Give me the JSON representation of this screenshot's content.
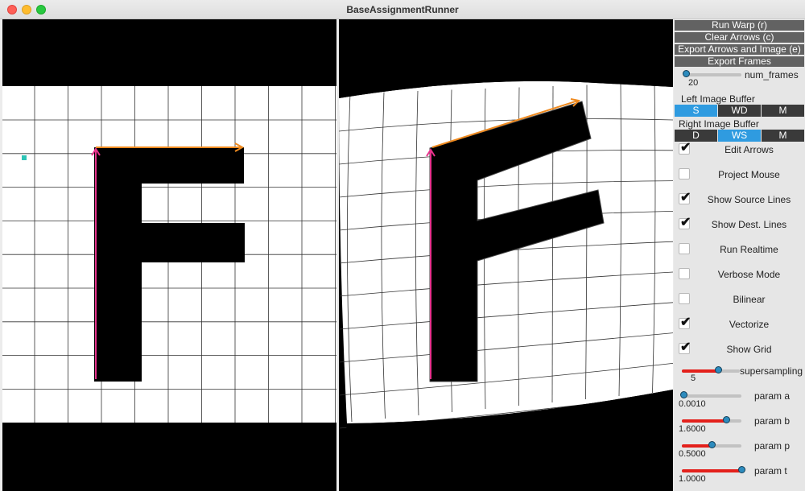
{
  "window": {
    "title": "BaseAssignmentRunner"
  },
  "colors": {
    "source_arrow": "#e8338d",
    "dest_arrow": "#ef8a1f",
    "accent": "#2f9be0",
    "slider_fill": "#e3201b",
    "marker": "#2ec4b6"
  },
  "buttons": {
    "run_warp": "Run Warp (r)",
    "clear_arrows": "Clear Arrows (c)",
    "export": "Export Arrows and Image (e)",
    "export_frames": "Export Frames"
  },
  "num_frames": {
    "label": "num_frames",
    "value": "20",
    "fraction": 0.04
  },
  "left_buffer": {
    "label": "Left Image Buffer",
    "options": [
      "S",
      "WD",
      "M"
    ],
    "selected": "S"
  },
  "right_buffer": {
    "label": "Right Image Buffer",
    "options": [
      "D",
      "WS",
      "M"
    ],
    "selected": "WS"
  },
  "checkboxes": [
    {
      "label": "Edit Arrows",
      "checked": true
    },
    {
      "label": "Project Mouse",
      "checked": false
    },
    {
      "label": "Show Source Lines",
      "checked": true
    },
    {
      "label": "Show Dest. Lines",
      "checked": true
    },
    {
      "label": "Run Realtime",
      "checked": false
    },
    {
      "label": "Verbose Mode",
      "checked": false
    },
    {
      "label": "Bilinear",
      "checked": false
    },
    {
      "label": "Vectorize",
      "checked": true
    },
    {
      "label": "Show Grid",
      "checked": true
    }
  ],
  "sliders": [
    {
      "label": "supersampling",
      "value": "5",
      "fraction": 0.62
    },
    {
      "label": "param a",
      "value": "0.0010",
      "fraction": 0.03
    },
    {
      "label": "param b",
      "value": "1.6000",
      "fraction": 0.74
    },
    {
      "label": "param p",
      "value": "0.5000",
      "fraction": 0.5
    },
    {
      "label": "param t",
      "value": "1.0000",
      "fraction": 1.0
    }
  ]
}
